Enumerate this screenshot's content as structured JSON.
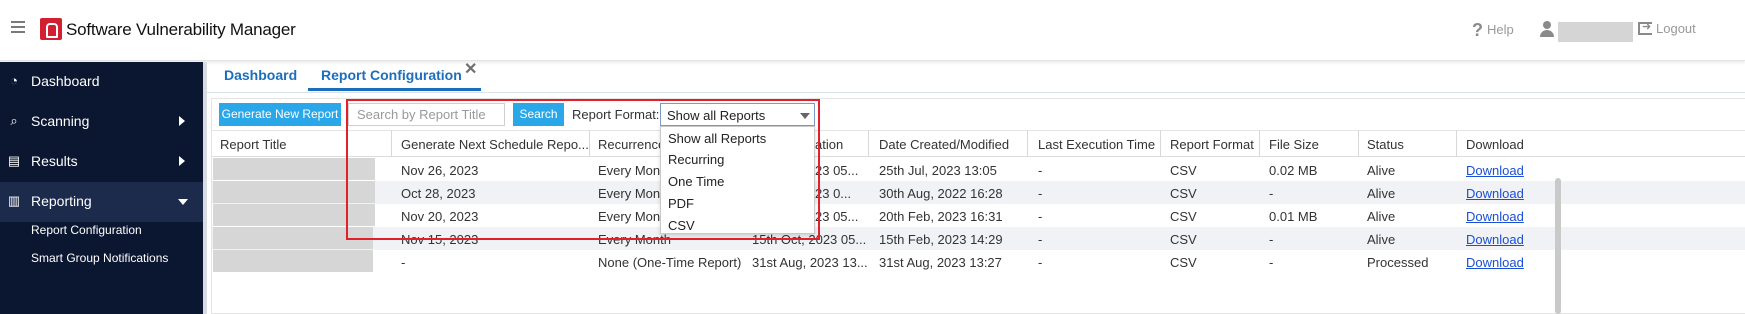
{
  "header": {
    "app_title": "Software Vulnerability Manager",
    "help_label": "Help",
    "logout_label": "Logout"
  },
  "sidebar": {
    "items": [
      {
        "label": "Dashboard",
        "icon": "dashboard-icon"
      },
      {
        "label": "Scanning",
        "icon": "scan-icon"
      },
      {
        "label": "Results",
        "icon": "clipboard-icon"
      },
      {
        "label": "Reporting",
        "icon": "chart-icon"
      }
    ],
    "sub_items": [
      "Report Configuration",
      "Smart Group Notifications"
    ]
  },
  "tabs": [
    "Dashboard",
    "Report Configuration"
  ],
  "toolbar": {
    "generate_label": "Generate New Report",
    "search_placeholder": "Search by Report Title",
    "search_button": "Search",
    "format_label": "Report Format:",
    "format_value": "Show all Reports"
  },
  "format_options": [
    "Show all Reports",
    "Recurring",
    "One Time",
    "PDF",
    "CSV"
  ],
  "table": {
    "columns": [
      "Report Title",
      "Generate Next Schedule Repo...",
      "Recurrence",
      "ation",
      "Date Created/Modified",
      "Last Execution Time",
      "Report Format",
      "File Size",
      "Status",
      "Download"
    ],
    "rows": [
      {
        "next": "Nov 26, 2023",
        "recurrence": "Every Mont",
        "last_exec_partial": "23 05...",
        "created": "25th Jul, 2023 13:05",
        "last_exec": "-",
        "format": "CSV",
        "size": "0.02 MB",
        "status": "Alive",
        "download": "Download"
      },
      {
        "next": "Oct 28, 2023",
        "recurrence": "Every Mont",
        "last_exec_partial": "23 0...",
        "created": "30th Aug, 2022 16:28",
        "last_exec": "-",
        "format": "CSV",
        "size": "-",
        "status": "Alive",
        "download": "Download"
      },
      {
        "next": "Nov 20, 2023",
        "recurrence": "Every Mont",
        "last_exec_partial": "23 05...",
        "created": "20th Feb, 2023 16:31",
        "last_exec": "-",
        "format": "CSV",
        "size": "0.01 MB",
        "status": "Alive",
        "download": "Download"
      },
      {
        "next": "Nov 15, 2023",
        "recurrence": "Every Month",
        "last_exec_partial": "15th Oct, 2023 05...",
        "created": "15th Feb, 2023 14:29",
        "last_exec": "-",
        "format": "CSV",
        "size": "-",
        "status": "Alive",
        "download": "Download"
      },
      {
        "next": "-",
        "recurrence": "None (One-Time Report)",
        "last_exec_partial": "31st Aug, 2023 13...",
        "created": "31st Aug, 2023 13:27",
        "last_exec": "-",
        "format": "CSV",
        "size": "-",
        "status": "Processed",
        "download": "Download"
      }
    ]
  }
}
